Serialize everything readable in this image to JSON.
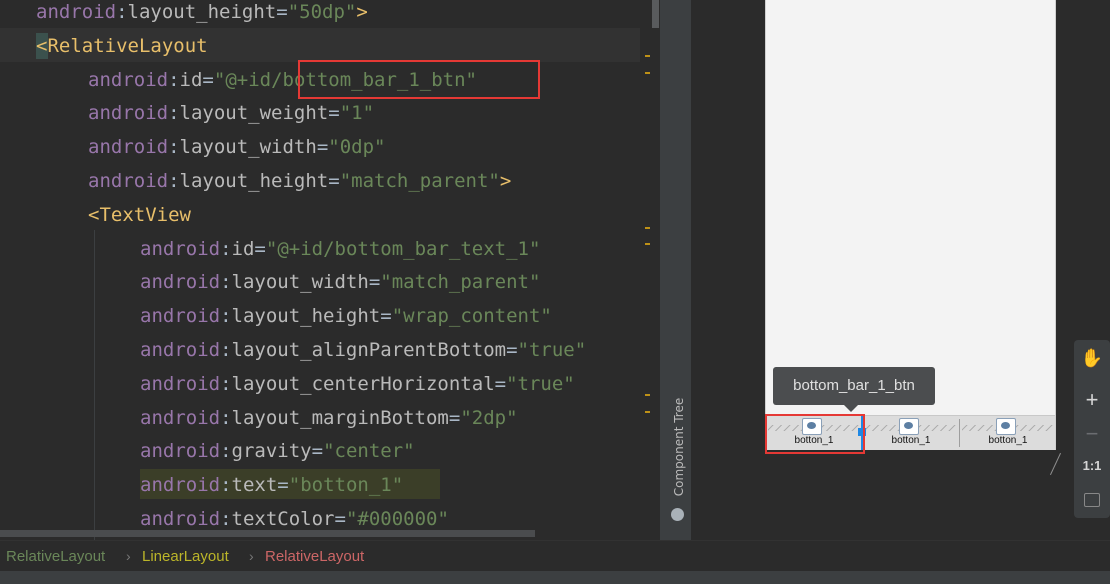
{
  "editor": {
    "lines": [
      {
        "indent": 36,
        "parts": [
          [
            "attr",
            "android"
          ],
          [
            "colon",
            ":"
          ],
          [
            "name",
            "layout_height"
          ],
          [
            "eq",
            "="
          ],
          [
            "str",
            "\"50dp\""
          ],
          [
            "punct",
            ">"
          ]
        ]
      },
      {
        "indent": 36,
        "parts": [
          [
            "punct",
            "<"
          ],
          [
            "tag",
            "RelativeLayout"
          ]
        ]
      },
      {
        "indent": 88,
        "parts": [
          [
            "attr",
            "android"
          ],
          [
            "colon",
            ":"
          ],
          [
            "name",
            "id"
          ],
          [
            "eq",
            "="
          ],
          [
            "str",
            "\"@+id/bottom_bar_1_btn\""
          ]
        ]
      },
      {
        "indent": 88,
        "parts": [
          [
            "attr",
            "android"
          ],
          [
            "colon",
            ":"
          ],
          [
            "name",
            "layout_weight"
          ],
          [
            "eq",
            "="
          ],
          [
            "str",
            "\"1\""
          ]
        ]
      },
      {
        "indent": 88,
        "parts": [
          [
            "attr",
            "android"
          ],
          [
            "colon",
            ":"
          ],
          [
            "name",
            "layout_width"
          ],
          [
            "eq",
            "="
          ],
          [
            "str",
            "\"0dp\""
          ]
        ]
      },
      {
        "indent": 88,
        "parts": [
          [
            "attr",
            "android"
          ],
          [
            "colon",
            ":"
          ],
          [
            "name",
            "layout_height"
          ],
          [
            "eq",
            "="
          ],
          [
            "str",
            "\"match_parent\""
          ],
          [
            "punct",
            ">"
          ]
        ]
      },
      {
        "indent": 88,
        "parts": [
          [
            "punct",
            "<"
          ],
          [
            "tag",
            "TextView"
          ]
        ]
      },
      {
        "indent": 140,
        "parts": [
          [
            "attr",
            "android"
          ],
          [
            "colon",
            ":"
          ],
          [
            "name",
            "id"
          ],
          [
            "eq",
            "="
          ],
          [
            "str",
            "\"@+id/bottom_bar_text_1\""
          ]
        ]
      },
      {
        "indent": 140,
        "parts": [
          [
            "attr",
            "android"
          ],
          [
            "colon",
            ":"
          ],
          [
            "name",
            "layout_width"
          ],
          [
            "eq",
            "="
          ],
          [
            "str",
            "\"match_parent\""
          ]
        ]
      },
      {
        "indent": 140,
        "parts": [
          [
            "attr",
            "android"
          ],
          [
            "colon",
            ":"
          ],
          [
            "name",
            "layout_height"
          ],
          [
            "eq",
            "="
          ],
          [
            "str",
            "\"wrap_content\""
          ]
        ]
      },
      {
        "indent": 140,
        "parts": [
          [
            "attr",
            "android"
          ],
          [
            "colon",
            ":"
          ],
          [
            "name",
            "layout_alignParentBottom"
          ],
          [
            "eq",
            "="
          ],
          [
            "str",
            "\"true\""
          ]
        ]
      },
      {
        "indent": 140,
        "parts": [
          [
            "attr",
            "android"
          ],
          [
            "colon",
            ":"
          ],
          [
            "name",
            "layout_centerHorizontal"
          ],
          [
            "eq",
            "="
          ],
          [
            "str",
            "\"true\""
          ]
        ]
      },
      {
        "indent": 140,
        "parts": [
          [
            "attr",
            "android"
          ],
          [
            "colon",
            ":"
          ],
          [
            "name",
            "layout_marginBottom"
          ],
          [
            "eq",
            "="
          ],
          [
            "str",
            "\"2dp\""
          ]
        ]
      },
      {
        "indent": 140,
        "parts": [
          [
            "attr",
            "android"
          ],
          [
            "colon",
            ":"
          ],
          [
            "name",
            "gravity"
          ],
          [
            "eq",
            "="
          ],
          [
            "str",
            "\"center\""
          ]
        ]
      },
      {
        "indent": 140,
        "parts": [
          [
            "attr",
            "android"
          ],
          [
            "colon",
            ":"
          ],
          [
            "name",
            "text"
          ],
          [
            "eq",
            "="
          ],
          [
            "str",
            "\"botton_1\""
          ]
        ]
      },
      {
        "indent": 140,
        "parts": [
          [
            "attr",
            "android"
          ],
          [
            "colon",
            ":"
          ],
          [
            "name",
            "textColor"
          ],
          [
            "eq",
            "="
          ],
          [
            "str",
            "\"#000000\""
          ]
        ]
      }
    ]
  },
  "side_panel": {
    "component_tree_label": "Component Tree"
  },
  "designer": {
    "tooltip": "bottom_bar_1_btn",
    "tabs": [
      {
        "label": "botton_1"
      },
      {
        "label": "botton_1"
      },
      {
        "label": "botton_1"
      }
    ],
    "zoom": {
      "hand_icon": "hand-icon",
      "plus": "+",
      "minus": "−",
      "one_to_one": "1:1"
    }
  },
  "breadcrumb": {
    "items": [
      "RelativeLayout",
      "LinearLayout",
      "RelativeLayout"
    ],
    "separator": "›"
  },
  "colors": {
    "attribute": "#9876aa",
    "string": "#6a8759",
    "tag": "#e8bf6a",
    "highlight_box": "#e53935"
  }
}
